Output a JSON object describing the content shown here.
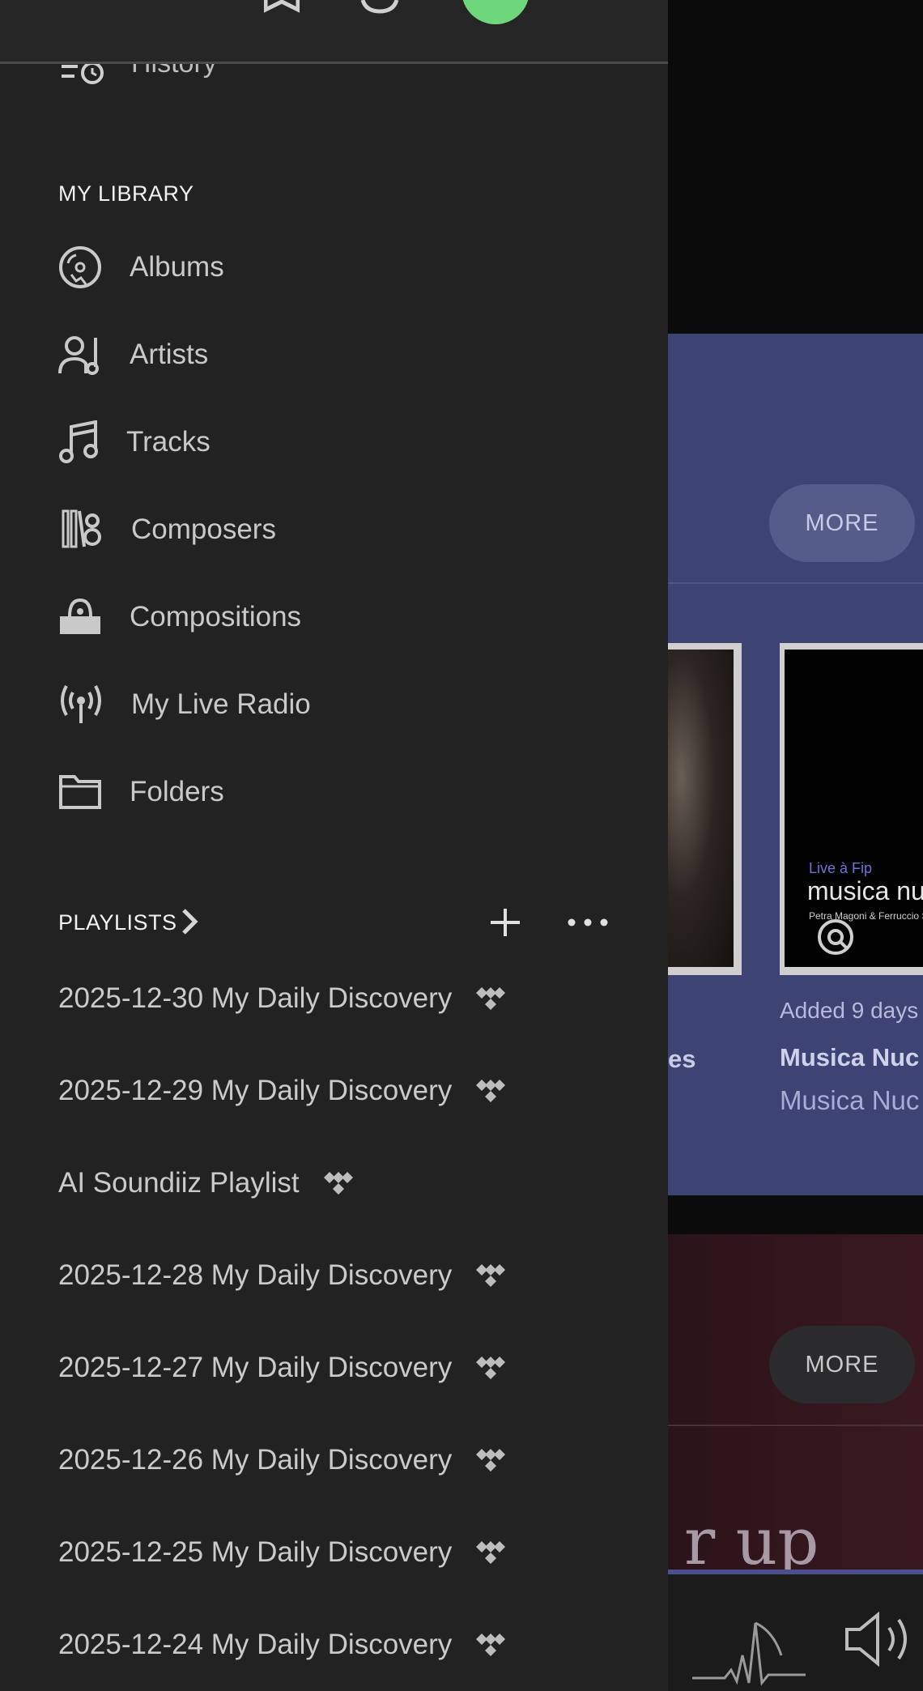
{
  "drawer": {
    "history_label": "History",
    "library_header": "MY LIBRARY",
    "library_items": [
      {
        "label": "Albums",
        "icon": "vinyl-icon"
      },
      {
        "label": "Artists",
        "icon": "artist-icon"
      },
      {
        "label": "Tracks",
        "icon": "music-note-icon"
      },
      {
        "label": "Composers",
        "icon": "composer-icon"
      },
      {
        "label": "Compositions",
        "icon": "composition-icon"
      },
      {
        "label": "My Live Radio",
        "icon": "radio-icon"
      },
      {
        "label": "Folders",
        "icon": "folder-icon"
      }
    ],
    "playlists_header": "PLAYLISTS",
    "playlists": [
      "2025-12-30 My Daily Discovery",
      "2025-12-29 My Daily Discovery",
      "AI Soundiiz Playlist",
      "2025-12-28 My Daily Discovery",
      "2025-12-27 My Daily Discovery",
      "2025-12-26 My Daily Discovery",
      "2025-12-25 My Daily Discovery",
      "2025-12-24 My Daily Discovery"
    ]
  },
  "main": {
    "section1": {
      "more_label": "MORE",
      "cut_title": "es",
      "card2": {
        "cover_line1": "Live à Fip",
        "cover_line2": "musica nuc",
        "cover_line3": "Petra Magoni & Ferruccio Sp",
        "added": "Added 9 days",
        "title": "Musica Nuc",
        "subtitle": "Musica Nuc"
      }
    },
    "section2": {
      "more_label": "MORE",
      "big_text": "r up"
    }
  },
  "colors": {
    "drawer_bg": "#222223",
    "blue_section": "#3d4373",
    "red_section": "#2a1419",
    "avatar": "#6fd77c"
  }
}
